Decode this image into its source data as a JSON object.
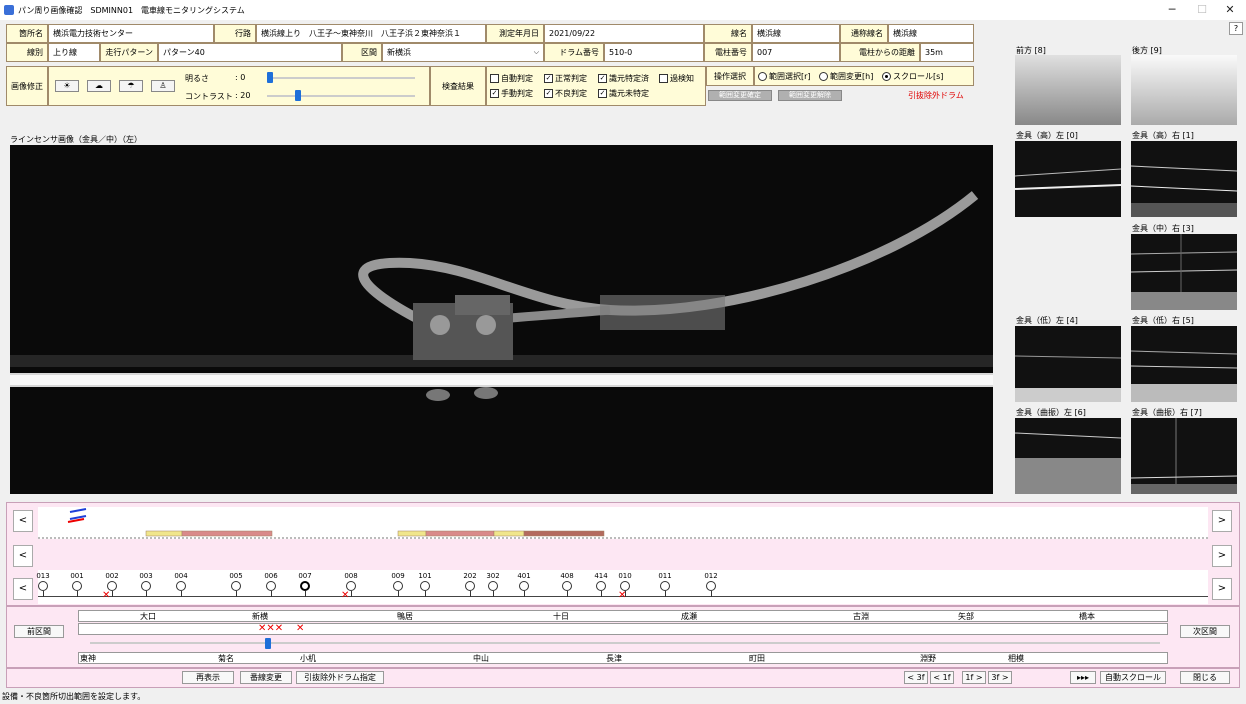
{
  "window": {
    "title": "パン周り画像確認　SDMINN01　電車線モニタリングシステム",
    "min": "─",
    "max": "☐",
    "close": "✕",
    "help": "?"
  },
  "header": {
    "office_label": "箇所名",
    "office_value": "横浜電力技術センター",
    "route_label": "行路",
    "route_value": "横浜線上り　八王子〜東神奈川　八王子浜２東神奈浜１",
    "date_label": "測定年月日",
    "date_value": "2021/09/22",
    "line_label": "線名",
    "line_value": "横浜線",
    "common_line_label": "通称線名",
    "common_line_value": "横浜線",
    "track_label": "線別",
    "track_value": "上り線",
    "pattern_label": "走行パターン",
    "pattern_value": "パターン40",
    "section_label": "区間",
    "section_value": "新横浜",
    "drum_label": "ドラム番号",
    "drum_value": "510-0",
    "pole_label": "電柱番号",
    "pole_value": "007",
    "distance_label": "電柱からの距離",
    "distance_value": "35m"
  },
  "imgcorr": {
    "label": "画像修正",
    "brightness_label": "明るさ",
    "brightness_value": ": 0",
    "contrast_label": "コントラスト",
    "contrast_value": ": 20",
    "brightness_level": 0,
    "contrast_level": 20
  },
  "inspection": {
    "label": "検査結果",
    "items": [
      {
        "label": "自動判定",
        "checked": false
      },
      {
        "label": "手動判定",
        "checked": true
      },
      {
        "label": "正常判定",
        "checked": true
      },
      {
        "label": "不良判定",
        "checked": true
      },
      {
        "label": "識元特定済",
        "checked": true
      },
      {
        "label": "識元未特定",
        "checked": true
      },
      {
        "label": "過検知",
        "checked": false
      }
    ]
  },
  "operation": {
    "label": "操作選択",
    "options": [
      "範囲選択[r]",
      "範囲変更[h]",
      "スクロール[s]"
    ],
    "selected": 2,
    "btn_confirm": "範囲変更確定",
    "btn_cancel": "範囲変更解除",
    "excluded": "引抜除外ドラム",
    "excluded_color": "#e00000"
  },
  "main_image_label": "ラインセンサ画像（金具／中）（左）",
  "thumbs": {
    "front": "前方 [8]",
    "rear": "後方 [9]",
    "high_left": "金具（高）左 [0]",
    "high_right": "金具（高）右 [1]",
    "mid_right": "金具（中）右 [3]",
    "low_left": "金具（低）左 [4]",
    "low_right": "金具（低）右 [5]",
    "curve_left": "金具（曲振）左 [6]",
    "curve_right": "金具（曲振）右 [7]"
  },
  "poles": [
    "013",
    "001",
    "002",
    "003",
    "004",
    "005",
    "006",
    "007",
    "008",
    "009",
    "101",
    "202",
    "302",
    "401",
    "408",
    "414",
    "010",
    "011",
    "012"
  ],
  "stations_top": [
    "大口",
    "新横",
    "鴨居",
    "十日",
    "成瀬",
    "古淵",
    "矢部",
    "橋本"
  ],
  "stations_bottom": [
    "東神",
    "菊名",
    "小机",
    "中山",
    "長津",
    "町田",
    "淵野",
    "相模"
  ],
  "marks": {
    "x_single": "✕",
    "x_triple": "✕✕✕"
  },
  "nav": {
    "left": "<",
    "right": ">",
    "prev_section": "前区間",
    "next_section": "次区間"
  },
  "bottom_buttons": {
    "redisplay": "再表示",
    "pole_change": "番線変更",
    "exclude_drum": "引抜除外ドラム指定",
    "back3": "< 3f",
    "back1": "< 1f",
    "fwd1": "1f >",
    "fwd3": "3f >",
    "fast": "▸▸▸",
    "autoscroll": "自動スクロール",
    "close": "閉じる"
  },
  "status": "設備・不良箇所切出範囲を設定します。",
  "colors": {
    "label_bg": "#fffcd8",
    "panel_pink": "#fde7f3",
    "yellow_seg": "#f0e68c",
    "pink_seg": "#d98a8a",
    "brown_seg": "#b36a5e",
    "slider": "#1e6fd9"
  }
}
